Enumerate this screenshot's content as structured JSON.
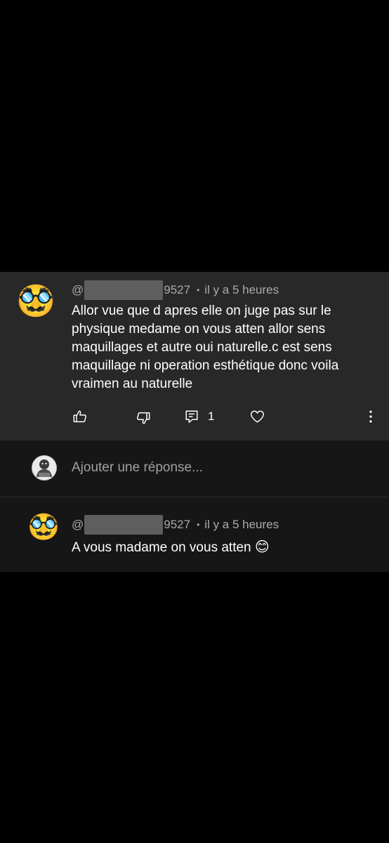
{
  "comment": {
    "avatar_emoji": "🥸",
    "handle_prefix": "@",
    "handle_suffix": "9527",
    "separator": "•",
    "time": "il y a 5 heures",
    "text": "Allor vue que d apres elle on juge pas sur le physique medame on vous atten allor sens maquillages et autre oui naturelle.c est sens maquillage ni operation esthétique donc voila vraimen au naturelle",
    "reply_count": "1",
    "icons": {
      "like": "thumbs-up-icon",
      "dislike": "thumbs-down-icon",
      "replies": "comment-icon",
      "heart": "heart-icon",
      "more": "more-vertical-icon"
    }
  },
  "reply_box": {
    "placeholder": "Ajouter une réponse..."
  },
  "reply": {
    "avatar_emoji": "🥸",
    "handle_prefix": "@",
    "handle_suffix": "9527",
    "separator": "•",
    "time": "il y a 5 heures",
    "text": "A vous madame on vous atten",
    "emoji": "😊"
  },
  "colors": {
    "background": "#000000",
    "comment_card": "#282828",
    "reply_area": "#161616",
    "meta_text": "#aaaaaa",
    "text": "#ffffff",
    "redaction": "#5e5e5e"
  }
}
